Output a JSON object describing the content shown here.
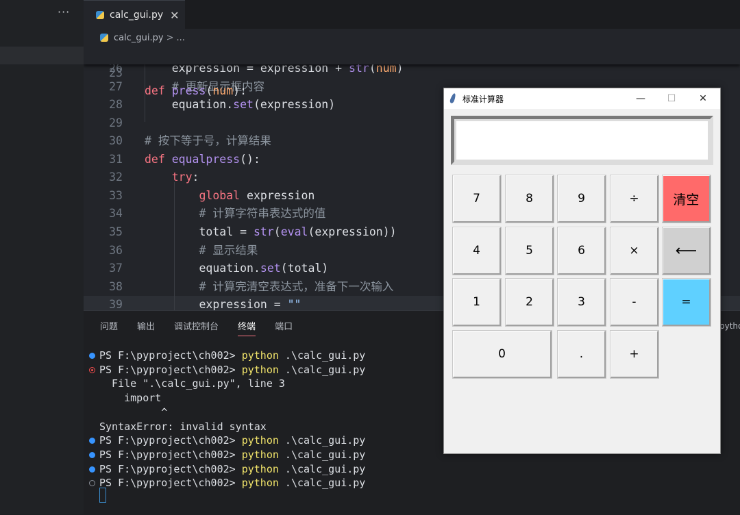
{
  "sidebar": {
    "more_label": "···"
  },
  "tab": {
    "filename": "calc_gui.py",
    "close": "✕"
  },
  "breadcrumb": {
    "file": "calc_gui.py",
    "sep": ">",
    "more": "..."
  },
  "editor": {
    "sticky": {
      "ln": "23",
      "code": [
        [
          "k",
          "def "
        ],
        [
          "f",
          "press"
        ],
        [
          "",
          "("
        ],
        [
          "p",
          "num"
        ],
        [
          "",
          "):"
        ]
      ]
    },
    "lines": [
      {
        "ln": "26",
        "code": [
          [
            "",
            "    expression = expression + "
          ],
          [
            "f",
            "str"
          ],
          [
            "",
            "("
          ],
          [
            "p",
            "num"
          ],
          [
            "",
            ")"
          ]
        ]
      },
      {
        "ln": "27",
        "code": [
          [
            "cm",
            "    # 更新显示框内容"
          ]
        ]
      },
      {
        "ln": "28",
        "code": [
          [
            "",
            "    equation."
          ],
          [
            "f",
            "set"
          ],
          [
            "",
            "(expression)"
          ]
        ]
      },
      {
        "ln": "29",
        "code": []
      },
      {
        "ln": "30",
        "code": [
          [
            "cm",
            "# 按下等于号，计算结果"
          ]
        ]
      },
      {
        "ln": "31",
        "code": [
          [
            "k",
            "def "
          ],
          [
            "f",
            "equalpress"
          ],
          [
            "",
            "():"
          ]
        ]
      },
      {
        "ln": "32",
        "code": [
          [
            "k",
            "    try"
          ],
          [
            "",
            ":"
          ]
        ]
      },
      {
        "ln": "33",
        "code": [
          [
            "k",
            "        global "
          ],
          [
            "",
            "expression"
          ]
        ]
      },
      {
        "ln": "34",
        "code": [
          [
            "cm",
            "        # 计算字符串表达式的值"
          ]
        ]
      },
      {
        "ln": "35",
        "code": [
          [
            "",
            "        total = "
          ],
          [
            "f",
            "str"
          ],
          [
            "",
            "("
          ],
          [
            "f",
            "eval"
          ],
          [
            "",
            "(expression))"
          ]
        ]
      },
      {
        "ln": "36",
        "code": [
          [
            "cm",
            "        # 显示结果"
          ]
        ]
      },
      {
        "ln": "37",
        "code": [
          [
            "",
            "        equation."
          ],
          [
            "f",
            "set"
          ],
          [
            "",
            "(total)"
          ]
        ]
      },
      {
        "ln": "38",
        "code": [
          [
            "cm",
            "        # 计算完清空表达式，准备下一次输入"
          ]
        ]
      },
      {
        "ln": "39",
        "code": [
          [
            "",
            "        expression = "
          ],
          [
            "s",
            "\"\""
          ]
        ]
      }
    ]
  },
  "panel": {
    "tabs": [
      "问题",
      "输出",
      "调试控制台",
      "终端",
      "端口"
    ],
    "active_tab": 3,
    "side_label": "pytho",
    "terminal": [
      {
        "status": "ok",
        "prompt": "PS F:\\pyproject\\ch002> ",
        "cmd": "python",
        "args": " .\\calc_gui.py"
      },
      {
        "status": "err",
        "prompt": "PS F:\\pyproject\\ch002> ",
        "cmd": "python",
        "args": " .\\calc_gui.py"
      },
      {
        "status": "",
        "text": "  File \".\\calc_gui.py\", line 3"
      },
      {
        "status": "",
        "text": "    import"
      },
      {
        "status": "",
        "text": "          ^"
      },
      {
        "status": "",
        "text": "SyntaxError: invalid syntax"
      },
      {
        "status": "ok",
        "prompt": "PS F:\\pyproject\\ch002> ",
        "cmd": "python",
        "args": " .\\calc_gui.py"
      },
      {
        "status": "ok",
        "prompt": "PS F:\\pyproject\\ch002> ",
        "cmd": "python",
        "args": " .\\calc_gui.py"
      },
      {
        "status": "ok",
        "prompt": "PS F:\\pyproject\\ch002> ",
        "cmd": "python",
        "args": " .\\calc_gui.py"
      },
      {
        "status": "none",
        "prompt": "PS F:\\pyproject\\ch002> ",
        "cmd": "python",
        "args": " .\\calc_gui.py"
      }
    ]
  },
  "calculator": {
    "title": "标准计算器",
    "minimize": "—",
    "maximize": "☐",
    "close": "✕",
    "display_value": "",
    "keys": {
      "k7": "7",
      "k8": "8",
      "k9": "9",
      "div": "÷",
      "clear": "清空",
      "k4": "4",
      "k5": "5",
      "k6": "6",
      "mul": "×",
      "back": "⟵",
      "k1": "1",
      "k2": "2",
      "k3": "3",
      "sub": "-",
      "eq": "=",
      "k0": "0",
      "dot": ".",
      "add": "+"
    }
  },
  "colors": {
    "keyword": "#f97583",
    "function": "#b392f0",
    "param": "#ffab70",
    "string": "#9ecbff",
    "comment": "#8b949e",
    "clear_key": "#ff6a6a",
    "equal_key": "#5fd0ff",
    "backspace_key": "#d0d0d0"
  }
}
